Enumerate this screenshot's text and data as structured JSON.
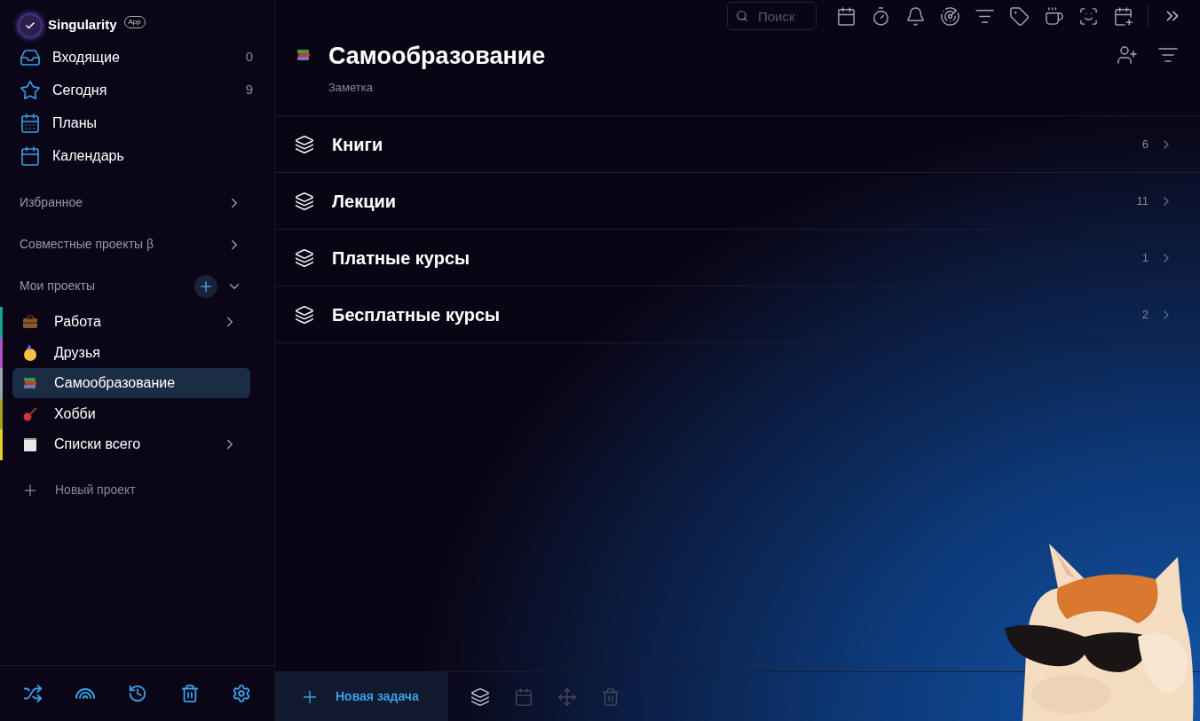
{
  "app": {
    "name": "Singularity",
    "badge": "App"
  },
  "nav": [
    {
      "label": "Входящие",
      "count": "0"
    },
    {
      "label": "Сегодня",
      "count": "9"
    },
    {
      "label": "Планы"
    },
    {
      "label": "Календарь"
    }
  ],
  "sections": [
    {
      "label": "Избранное"
    },
    {
      "label": "Совместные проекты β"
    }
  ],
  "projects_header": {
    "label": "Мои проекты",
    "expanded": true
  },
  "projects": [
    {
      "name": "Работа",
      "color": "#16a394",
      "expandable": true,
      "selected": false
    },
    {
      "name": "Друзья",
      "color": "#b04fc4",
      "expandable": false,
      "selected": false
    },
    {
      "name": "Самообразование",
      "color": "#9aa6b2",
      "expandable": false,
      "selected": true
    },
    {
      "name": "Хобби",
      "color": "#a7a21c",
      "expandable": false,
      "selected": false
    },
    {
      "name": "Списки всего",
      "color": "#e3cf1f",
      "expandable": true,
      "selected": false
    }
  ],
  "new_project": "Новый проект",
  "search": {
    "placeholder": "Поиск"
  },
  "page": {
    "title": "Самообразование",
    "subtitle": "Заметка"
  },
  "groups": [
    {
      "name": "Книги",
      "count": "6"
    },
    {
      "name": "Лекции",
      "count": "11"
    },
    {
      "name": "Платные курсы",
      "count": "1"
    },
    {
      "name": "Бесплатные курсы",
      "count": "2"
    }
  ],
  "new_task": "Новая задача",
  "task_tools": [
    {
      "kind": "layers",
      "disabled": false
    },
    {
      "kind": "date",
      "disabled": true
    },
    {
      "kind": "move",
      "disabled": true
    },
    {
      "kind": "delete",
      "disabled": true
    }
  ]
}
